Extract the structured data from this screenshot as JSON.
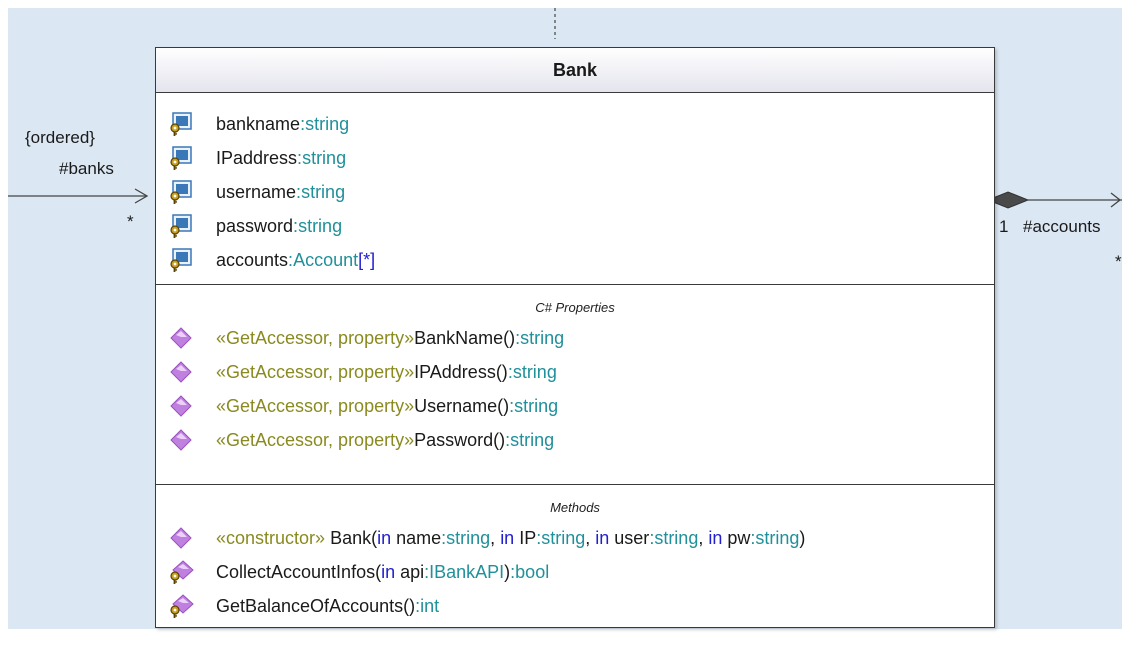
{
  "colors": {
    "canvas_bg": "#dbe7f3",
    "type": "#20909a",
    "stereotype": "#8a8a20",
    "keyword": "#2020d0",
    "text": "#1a1a1a",
    "operation_icon": "#c080e0",
    "property_icon": "#3a78b8",
    "key_icon": "#c8a020"
  },
  "left_association": {
    "constraint": "{ordered}",
    "role": "#banks",
    "multiplicity": "*"
  },
  "right_association": {
    "multiplicity": "1",
    "role": "#accounts",
    "far_multiplicity": "*"
  },
  "class": {
    "name": "Bank",
    "attributes": [
      {
        "icon": "protected-property-icon",
        "name": "bankname",
        "sep": ":",
        "type": "string",
        "mult": ""
      },
      {
        "icon": "protected-property-icon",
        "name": "IPaddress",
        "sep": ":",
        "type": "string",
        "mult": ""
      },
      {
        "icon": "protected-property-icon",
        "name": "username",
        "sep": ":",
        "type": "string",
        "mult": ""
      },
      {
        "icon": "protected-property-icon",
        "name": "password",
        "sep": ":",
        "type": "string",
        "mult": ""
      },
      {
        "icon": "protected-property-icon",
        "name": "accounts",
        "sep": ":",
        "type": "Account",
        "mult": "[*]"
      }
    ],
    "properties_title": "C# Properties",
    "properties": [
      {
        "icon": "public-operation-icon",
        "stereotype": "«GetAccessor, property»",
        "name": " BankName()",
        "ret": ":string"
      },
      {
        "icon": "public-operation-icon",
        "stereotype": "«GetAccessor, property»",
        "name": " IPAddress()",
        "ret": ":string"
      },
      {
        "icon": "public-operation-icon",
        "stereotype": "«GetAccessor, property»",
        "name": " Username()",
        "ret": ":string"
      },
      {
        "icon": "public-operation-icon",
        "stereotype": "«GetAccessor, property»",
        "name": " Password()",
        "ret": ":string"
      }
    ],
    "methods_title": "Methods",
    "methods": [
      {
        "icon": "public-operation-icon",
        "stereotype": "«constructor»",
        "name": " Bank(",
        "params": [
          {
            "kw": "in",
            "name": " name",
            "type": ":string",
            "sep": ", "
          },
          {
            "kw": "in",
            "name": " IP",
            "type": ":string",
            "sep": ", "
          },
          {
            "kw": "in",
            "name": " user",
            "type": ":string",
            "sep": ", "
          },
          {
            "kw": "in",
            "name": " pw",
            "type": ":string",
            "sep": ""
          }
        ],
        "close": ")",
        "ret": ""
      },
      {
        "icon": "protected-operation-icon",
        "stereotype": "",
        "name": "CollectAccountInfos(",
        "params": [
          {
            "kw": "in",
            "name": " api",
            "type": ":IBankAPI",
            "sep": ""
          }
        ],
        "close": ")",
        "ret": ":bool"
      },
      {
        "icon": "protected-operation-icon",
        "stereotype": "",
        "name": "GetBalanceOfAccounts(",
        "params": [],
        "close": ")",
        "ret": ":int"
      }
    ]
  }
}
